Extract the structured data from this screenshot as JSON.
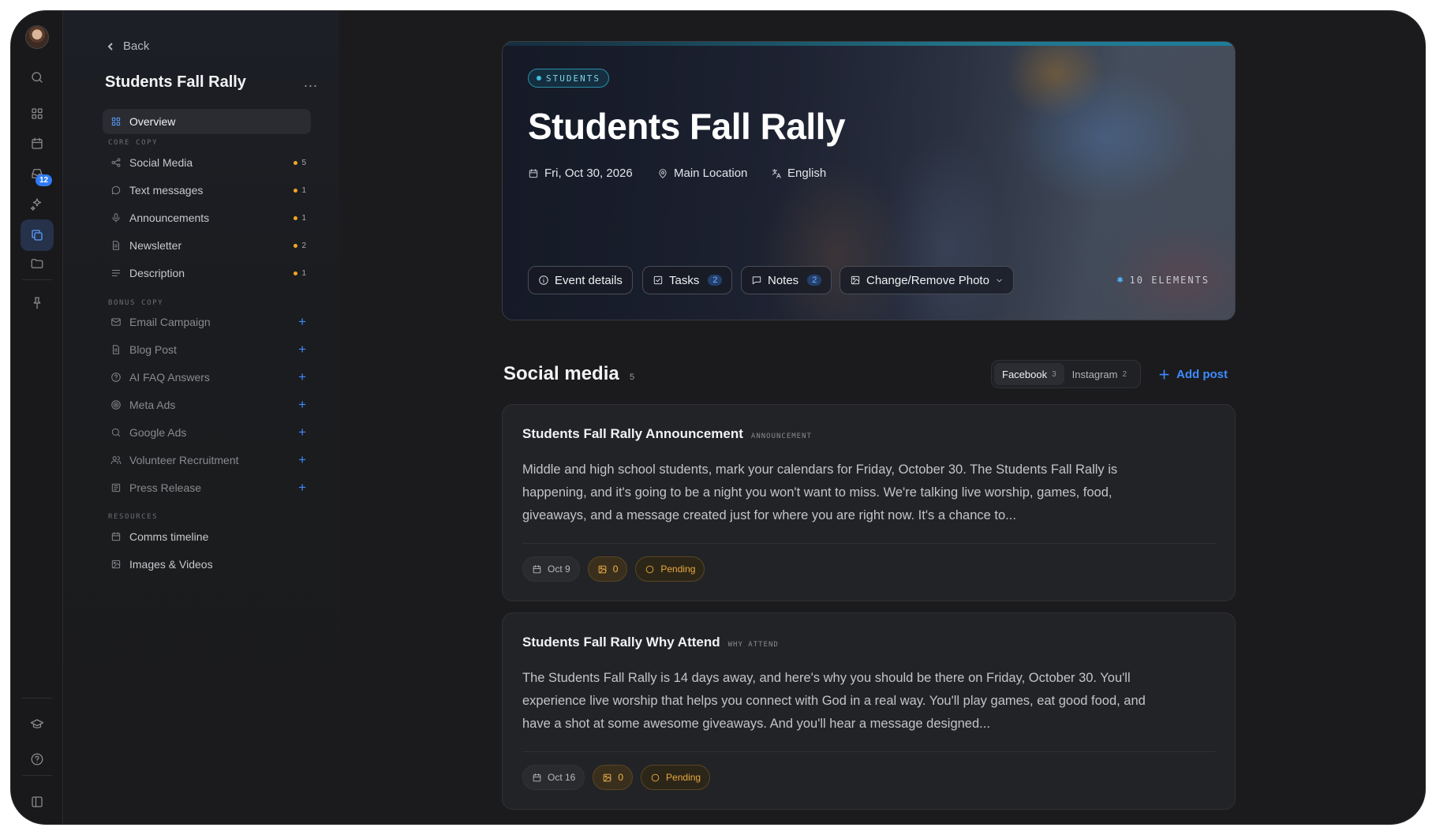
{
  "colors": {
    "accent": "#3d8bff",
    "hero_bar": "#2bb7d3",
    "pending": "#eaa93b",
    "dot": "#f5a524"
  },
  "rail": {
    "inbox_badge": "12",
    "icons": [
      "search-icon",
      "grid-icon",
      "calendar-icon",
      "inbox-icon",
      "sparkles-icon",
      "copy-icon",
      "folder-icon",
      "pin-icon",
      "graduation-cap-icon",
      "help-icon",
      "sidebar-toggle-icon"
    ]
  },
  "sidebar": {
    "back_label": "Back",
    "title": "Students Fall Rally",
    "more_label": "...",
    "overview": "Overview",
    "sections": {
      "core": "CORE COPY",
      "bonus": "BONUS COPY",
      "resources": "RESOURCES"
    },
    "core_items": [
      {
        "label": "Social Media",
        "count": "5"
      },
      {
        "label": "Text messages",
        "count": "1"
      },
      {
        "label": "Announcements",
        "count": "1"
      },
      {
        "label": "Newsletter",
        "count": "2"
      },
      {
        "label": "Description",
        "count": "1"
      }
    ],
    "bonus_items": [
      {
        "label": "Email Campaign"
      },
      {
        "label": "Blog Post"
      },
      {
        "label": "AI FAQ Answers"
      },
      {
        "label": "Meta Ads"
      },
      {
        "label": "Google Ads"
      },
      {
        "label": "Volunteer Recruitment"
      },
      {
        "label": "Press Release"
      }
    ],
    "resource_items": [
      {
        "label": "Comms timeline"
      },
      {
        "label": "Images & Videos"
      }
    ],
    "plus": "+"
  },
  "hero": {
    "tag": "STUDENTS",
    "title": "Students Fall Rally",
    "date": "Fri, Oct 30, 2026",
    "location": "Main Location",
    "language": "English",
    "buttons": {
      "event_details": "Event details",
      "tasks": "Tasks",
      "tasks_count": "2",
      "notes": "Notes",
      "notes_count": "2",
      "photo": "Change/Remove Photo"
    },
    "elements": "10 ELEMENTS"
  },
  "social": {
    "title": "Social media",
    "count": "5",
    "tabs": [
      {
        "label": "Facebook",
        "count": "3"
      },
      {
        "label": "Instagram",
        "count": "2"
      }
    ],
    "add_post": "Add post",
    "posts": [
      {
        "title": "Students Fall Rally Announcement",
        "kind": "ANNOUNCEMENT",
        "body": "Middle and high school students, mark your calendars for Friday, October 30. The Students Fall Rally is happening, and it's going to be a night you won't want to miss. We're talking live worship, games, food, giveaways, and a message created just for where you are right now. It's a chance to...",
        "date": "Oct 9",
        "images": "0",
        "status": "Pending"
      },
      {
        "title": "Students Fall Rally Why Attend",
        "kind": "WHY ATTEND",
        "body": "The Students Fall Rally is 14 days away, and here's why you should be there on Friday, October 30. You'll experience live worship that helps you connect with God in a real way. You'll play games, eat good food, and have a shot at some awesome giveaways. And you'll hear a message designed...",
        "date": "Oct 16",
        "images": "0",
        "status": "Pending"
      }
    ]
  }
}
